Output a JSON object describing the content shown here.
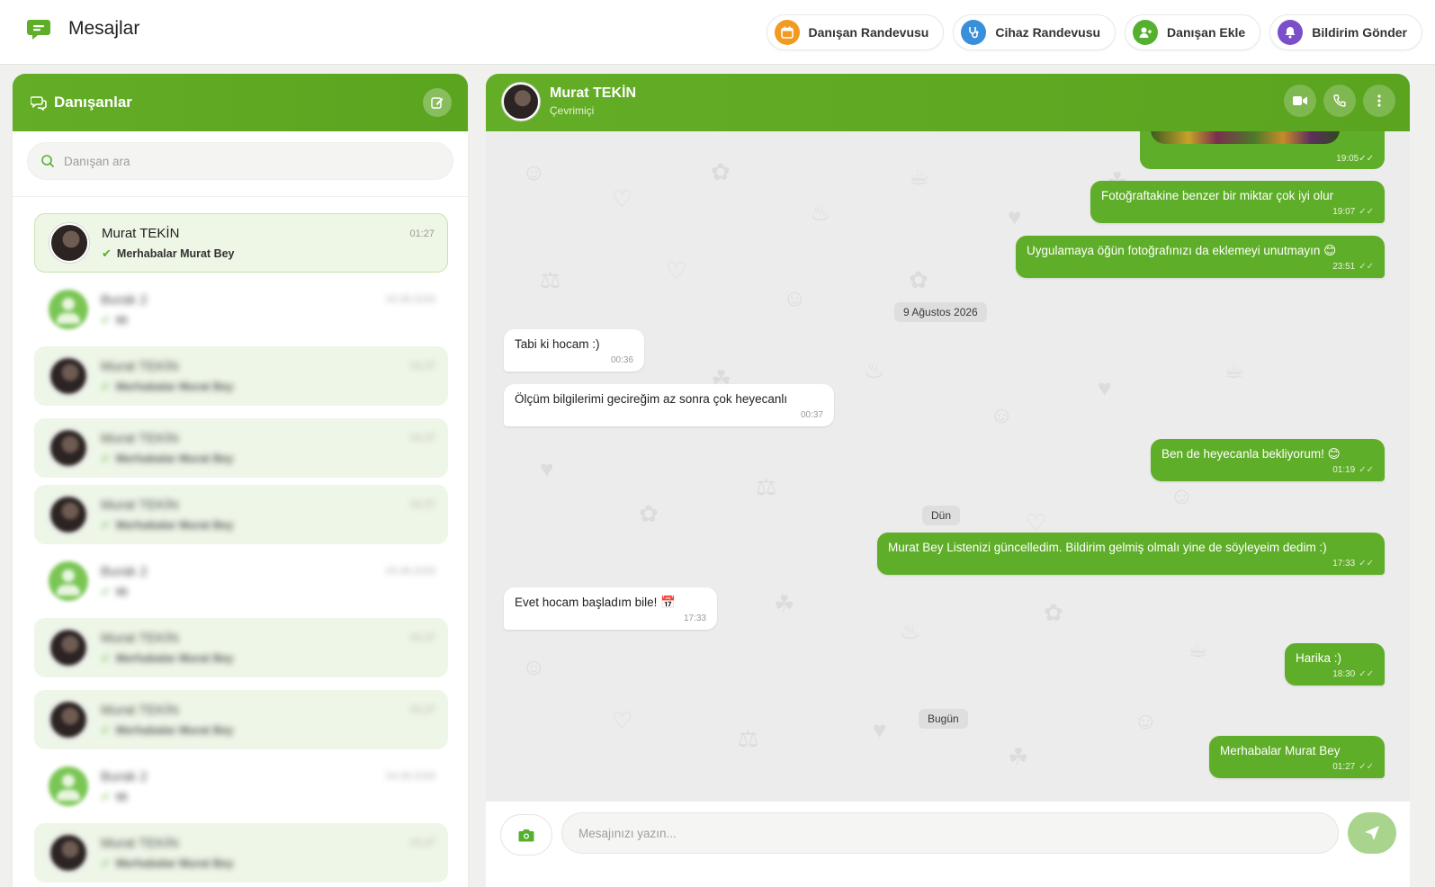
{
  "header": {
    "title": "Mesajlar",
    "actions": [
      {
        "label": "Danışan Randevusu",
        "icon": "calendar-icon",
        "color": "#f39a21"
      },
      {
        "label": "Cihaz Randevusu",
        "icon": "stethoscope-icon",
        "color": "#3a8fd9"
      },
      {
        "label": "Danışan Ekle",
        "icon": "add-user-icon",
        "color": "#56b030"
      },
      {
        "label": "Bildirim Gönder",
        "icon": "bell-icon",
        "color": "#7b4fc9"
      }
    ]
  },
  "sidebar": {
    "title": "Danışanlar",
    "search_placeholder": "Danışan ara",
    "conversations": [
      {
        "name": "Murat TEKİN",
        "last": "Merhabalar Murat Bey",
        "time": "01:27",
        "avatar": "photo",
        "active": true
      },
      {
        "name": "Burak 2",
        "last": "ttt",
        "time": "04.08.2026",
        "avatar": "generic",
        "active": false
      },
      {
        "name": "Murat TEKİN",
        "last": "Merhabalar Murat Bey",
        "time": "01:27",
        "avatar": "photo",
        "active": false
      },
      {
        "name": "Murat TEKİN",
        "last": "Merhabalar Murat Bey",
        "time": "01:27",
        "avatar": "photo",
        "active": false
      },
      {
        "name": "Murat TEKİN",
        "last": "Merhabalar Murat Bey",
        "time": "01:27",
        "avatar": "photo",
        "active": false
      },
      {
        "name": "Burak 2",
        "last": "ttt",
        "time": "04.08.2026",
        "avatar": "generic",
        "active": false
      },
      {
        "name": "Murat TEKİN",
        "last": "Merhabalar Murat Bey",
        "time": "01:27",
        "avatar": "photo",
        "active": false
      },
      {
        "name": "Murat TEKİN",
        "last": "Merhabalar Murat Bey",
        "time": "01:27",
        "avatar": "photo",
        "active": false
      },
      {
        "name": "Burak 2",
        "last": "ttt",
        "time": "04.08.2026",
        "avatar": "generic",
        "active": false
      },
      {
        "name": "Murat TEKİN",
        "last": "Merhabalar Murat Bey",
        "time": "01:27",
        "avatar": "photo",
        "active": false
      }
    ]
  },
  "chat": {
    "contact_name": "Murat TEKİN",
    "contact_status": "Çevrimiçi",
    "header_buttons": [
      "video-icon",
      "phone-icon",
      "more-vertical-icon"
    ],
    "photo_time": "19:05",
    "messages": [
      {
        "kind": "msg",
        "dir": "out",
        "text": "Fotoğraftakine benzer bir miktar çok iyi olur",
        "time": "19:07"
      },
      {
        "kind": "msg",
        "dir": "out",
        "text": "Uygulamaya öğün fotoğrafınızı da eklemeyi unutmayın 😊",
        "time": "23:51"
      },
      {
        "kind": "day",
        "text": "9 Ağustos 2026"
      },
      {
        "kind": "msg",
        "dir": "in",
        "text": "Tabi ki hocam :)",
        "time": "00:36"
      },
      {
        "kind": "msg",
        "dir": "in",
        "text": "Ölçüm bilgilerimi gecireğim az sonra çok heyecanlı",
        "time": "00:37"
      },
      {
        "kind": "msg",
        "dir": "out",
        "text": "Ben de heyecanla bekliyorum! 😊",
        "time": "01:19"
      },
      {
        "kind": "day",
        "text": "Dün"
      },
      {
        "kind": "msg",
        "dir": "out",
        "text": "Murat Bey Listenizi güncelledim. Bildirim gelmiş olmalı yine de söyleyeim dedim :)",
        "time": "17:33"
      },
      {
        "kind": "msg",
        "dir": "in",
        "text": "Evet hocam başladım bile! 📅",
        "time": "17:33"
      },
      {
        "kind": "msg",
        "dir": "out",
        "text": "Harika :)",
        "time": "18:30"
      },
      {
        "kind": "day",
        "text": "Bugün"
      },
      {
        "kind": "msg",
        "dir": "out",
        "text": "Merhabalar Murat Bey",
        "time": "01:27"
      }
    ],
    "input_placeholder": "Mesajınızı yazın..."
  }
}
